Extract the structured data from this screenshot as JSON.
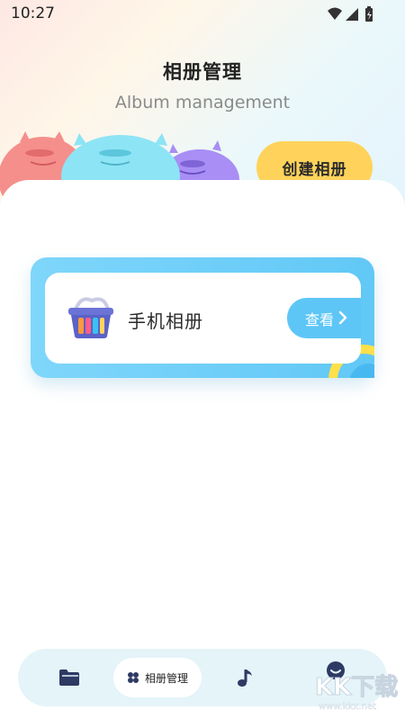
{
  "status_bar": {
    "time": "10:27"
  },
  "header": {
    "title": "相册管理",
    "subtitle": "Album management",
    "create_button": "创建相册"
  },
  "albums": [
    {
      "name": "手机相册",
      "action": "查看"
    }
  ],
  "bottom_nav": {
    "items": [
      {
        "icon": "folder-icon",
        "label": ""
      },
      {
        "icon": "clover-icon",
        "label": "相册管理",
        "active": true
      },
      {
        "icon": "music-note-icon",
        "label": ""
      },
      {
        "icon": "smile-icon",
        "label": ""
      }
    ]
  },
  "watermark": {
    "text": "KK下载",
    "url": "www.kkx.net"
  },
  "colors": {
    "accent_yellow": "#ffd35b",
    "accent_blue": "#5ec6f6",
    "nav_bg": "#e4f4f9"
  }
}
